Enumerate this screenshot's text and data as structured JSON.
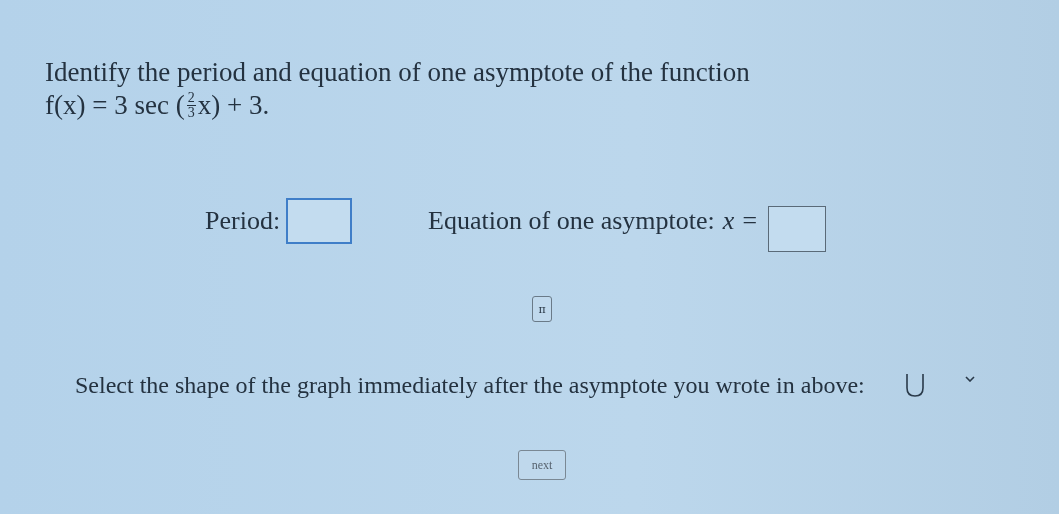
{
  "question": {
    "text": "Identify the period and equation of one asymptote of the function",
    "formula": {
      "before": "f(x) = 3 sec (",
      "numerator": "2",
      "denominator": "3",
      "after": "x) + 3."
    }
  },
  "period": {
    "label": "Period:"
  },
  "asymptote": {
    "label": "Equation of one asymptote:",
    "variable": "x ="
  },
  "pi_button": {
    "label": "π"
  },
  "shape_question": {
    "label": "Select the shape of the graph immediately after the asymptote you wrote in above:",
    "kind": "u"
  },
  "next_button": {
    "label": "next"
  }
}
